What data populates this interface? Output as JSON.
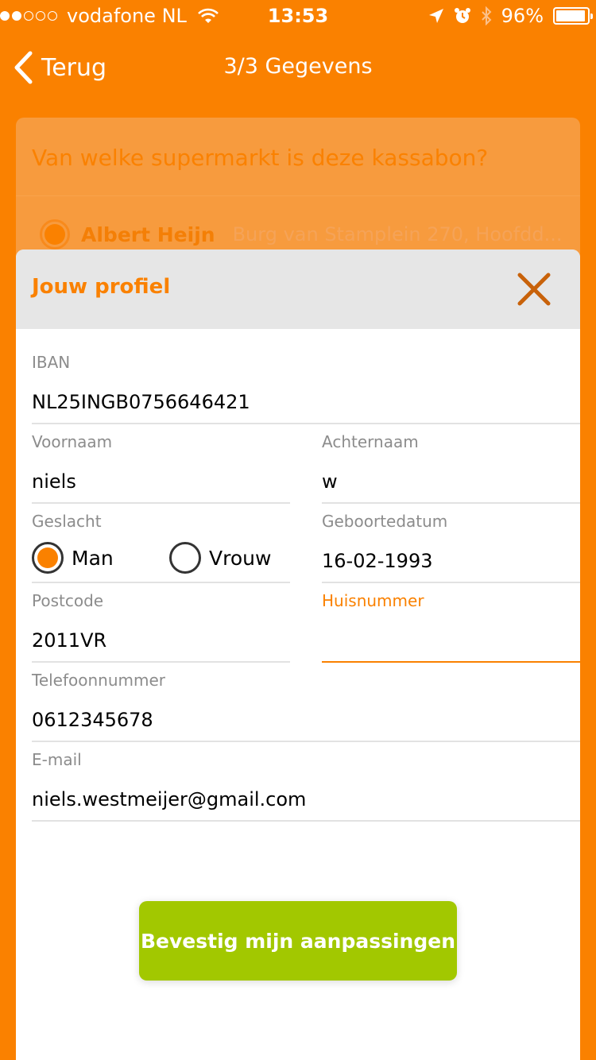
{
  "status_bar": {
    "signal_dots": 5,
    "signal_filled": 2,
    "carrier": "vodafone NL",
    "time": "13:53",
    "battery": "96%",
    "battery_level": 0.96,
    "icons": [
      "wifi-icon",
      "location-arrow-icon",
      "alarm-icon",
      "bluetooth-icon",
      "battery-icon"
    ]
  },
  "nav": {
    "back_label": "Terug",
    "title": "3/3 Gegevens"
  },
  "question_card": {
    "question": "Van welke supermarkt is deze kassabon?",
    "option_store": "Albert Heijn",
    "option_address": "Burg van Stamplein 270, Hoofdd..."
  },
  "modal": {
    "title": "Jouw profiel",
    "fields": {
      "iban": {
        "label": "IBAN",
        "value": "NL25INGB0756646421"
      },
      "first_name": {
        "label": "Voornaam",
        "value": "niels"
      },
      "last_name": {
        "label": "Achternaam",
        "value": "w"
      },
      "gender": {
        "label": "Geslacht",
        "options": [
          "Man",
          "Vrouw"
        ],
        "selected": "Man"
      },
      "birthdate": {
        "label": "Geboortedatum",
        "value": "16-02-1993"
      },
      "postcode": {
        "label": "Postcode",
        "value": "2011VR"
      },
      "house_number": {
        "label": "Huisnummer",
        "value": ""
      },
      "phone": {
        "label": "Telefoonnummer",
        "value": "0612345678"
      },
      "email": {
        "label": "E-mail",
        "value": "niels.westmeijer@gmail.com"
      }
    },
    "confirm_label": "Bevestig mijn aanpassingen"
  },
  "colors": {
    "brand_orange": "#FA8100",
    "confirm_green": "#A2C800",
    "header_gray": "#E6E6E6"
  }
}
